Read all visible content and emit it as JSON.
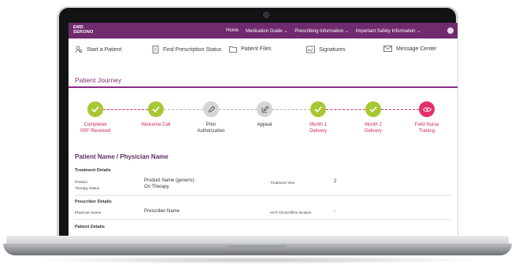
{
  "nav": {
    "logo_line1": "EMD",
    "logo_line2": "SERONO",
    "links": [
      {
        "label": "Home"
      },
      {
        "label": "Medication Guide ⌄"
      },
      {
        "label": "Prescribing Information ⌄"
      },
      {
        "label": "Important Safety Information ⌄"
      }
    ]
  },
  "toolbar": {
    "items": [
      {
        "label": "Start a Patient",
        "icon": "person-icon"
      },
      {
        "label": "Find Prescription Status",
        "icon": "document-icon"
      },
      {
        "label": "Patient Files",
        "icon": "folder-icon"
      },
      {
        "label": "Signatures",
        "icon": "signature-icon"
      },
      {
        "label": "Message Center",
        "icon": "envelope-icon"
      }
    ]
  },
  "journey": {
    "title": "Patient Journey",
    "steps": [
      {
        "label": "Completed\nSRF Received",
        "state": "done"
      },
      {
        "label": "Welcome Call",
        "state": "done"
      },
      {
        "label": "Prior\nAuthorization",
        "state": "pending",
        "icon": "pen-icon"
      },
      {
        "label": "Appeal",
        "state": "pending",
        "icon": "edit-icon"
      },
      {
        "label": "Month 1\nDelivery",
        "state": "done"
      },
      {
        "label": "Month 2\nDelivery",
        "state": "done"
      },
      {
        "label": "Field Nurse\nTraning",
        "state": "current",
        "icon": "eye-icon"
      }
    ]
  },
  "patient": {
    "heading": "Patient Name / Physician Name",
    "treatment_header": "Treatment Details",
    "product_label": "Product",
    "product_value": "Product Name (generic)",
    "therapy_label": "Therapy Status",
    "therapy_value": "On Therapy",
    "treatment_year_label": "Treatment Year",
    "treatment_year_value": "2",
    "prescriber_header": "Prescriber Details",
    "physician_label": "Physician Name",
    "physician_value": "Prescriber Name",
    "clinic_label": "HCP Clinic/Office location",
    "clinic_value": "-",
    "patient_header": "Patient Details"
  },
  "colors": {
    "brand": "#702a6e",
    "done": "#a7c832",
    "pending": "#d5d5d5",
    "current": "#e3316a",
    "label_pink": "#d4235c"
  }
}
